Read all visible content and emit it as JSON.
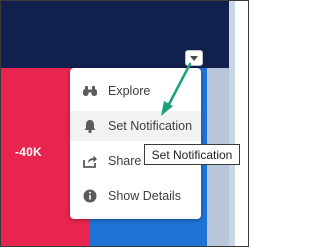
{
  "chart": {
    "value_label": "-40K",
    "colors": {
      "background": "#12204d",
      "negative_bar": "#e8254f",
      "positive_bar": "#1f73d6"
    }
  },
  "menu": {
    "toggle_icon": "chevron-down-icon",
    "items": [
      {
        "label": "Explore",
        "icon": "binoculars-icon"
      },
      {
        "label": "Set Notification",
        "icon": "bell-icon"
      },
      {
        "label": "Share",
        "icon": "share-icon"
      },
      {
        "label": "Show Details",
        "icon": "info-icon"
      }
    ]
  },
  "tooltip": {
    "text": "Set Notification"
  },
  "annotation": {
    "arrow_color": "#1aa37a"
  }
}
